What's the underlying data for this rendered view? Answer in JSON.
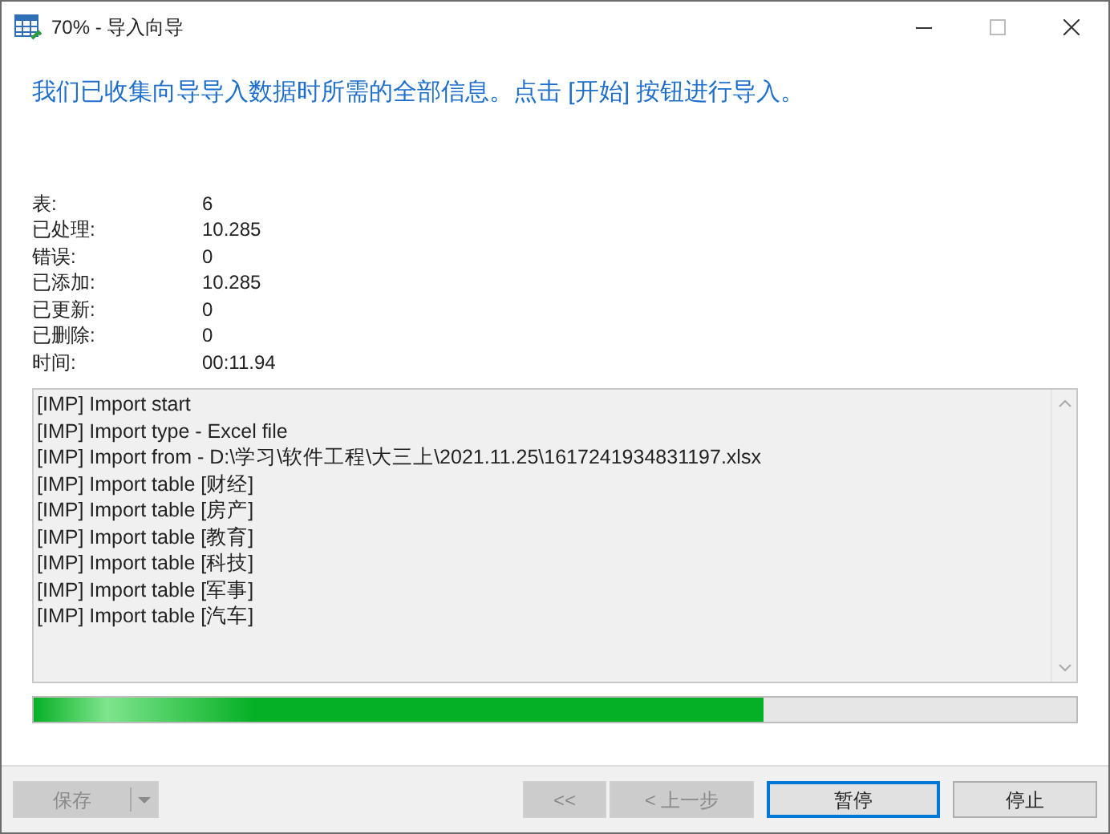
{
  "window": {
    "title": "70% - 导入向导"
  },
  "heading": "我们已收集向导导入数据时所需的全部信息。点击 [开始] 按钮进行导入。",
  "stats": [
    {
      "label": "表:",
      "value": "6"
    },
    {
      "label": "已处理:",
      "value": "10.285"
    },
    {
      "label": "错误:",
      "value": "0"
    },
    {
      "label": "已添加:",
      "value": "10.285"
    },
    {
      "label": "已更新:",
      "value": "0"
    },
    {
      "label": "已删除:",
      "value": "0"
    },
    {
      "label": "时间:",
      "value": "00:11.94"
    }
  ],
  "log": [
    "[IMP] Import start",
    "[IMP] Import type - Excel file",
    "[IMP] Import from - D:\\学习\\软件工程\\大三上\\2021.11.25\\1617241934831197.xlsx",
    "[IMP] Import table [财经]",
    "[IMP] Import table [房产]",
    "[IMP] Import table [教育]",
    "[IMP] Import table [科技]",
    "[IMP] Import table [军事]",
    "[IMP] Import table [汽车]"
  ],
  "progress": {
    "level": 0.7
  },
  "footer": {
    "save_button": {
      "label": "保存",
      "disabled": true
    },
    "buttons": [
      {
        "label": "<<",
        "disabled": true,
        "focused": false
      },
      {
        "label": "< 上一步",
        "disabled": true,
        "focused": false
      },
      {
        "label": "暂停",
        "disabled": false,
        "focused": true
      },
      {
        "label": "停止",
        "disabled": false,
        "focused": false
      }
    ]
  }
}
